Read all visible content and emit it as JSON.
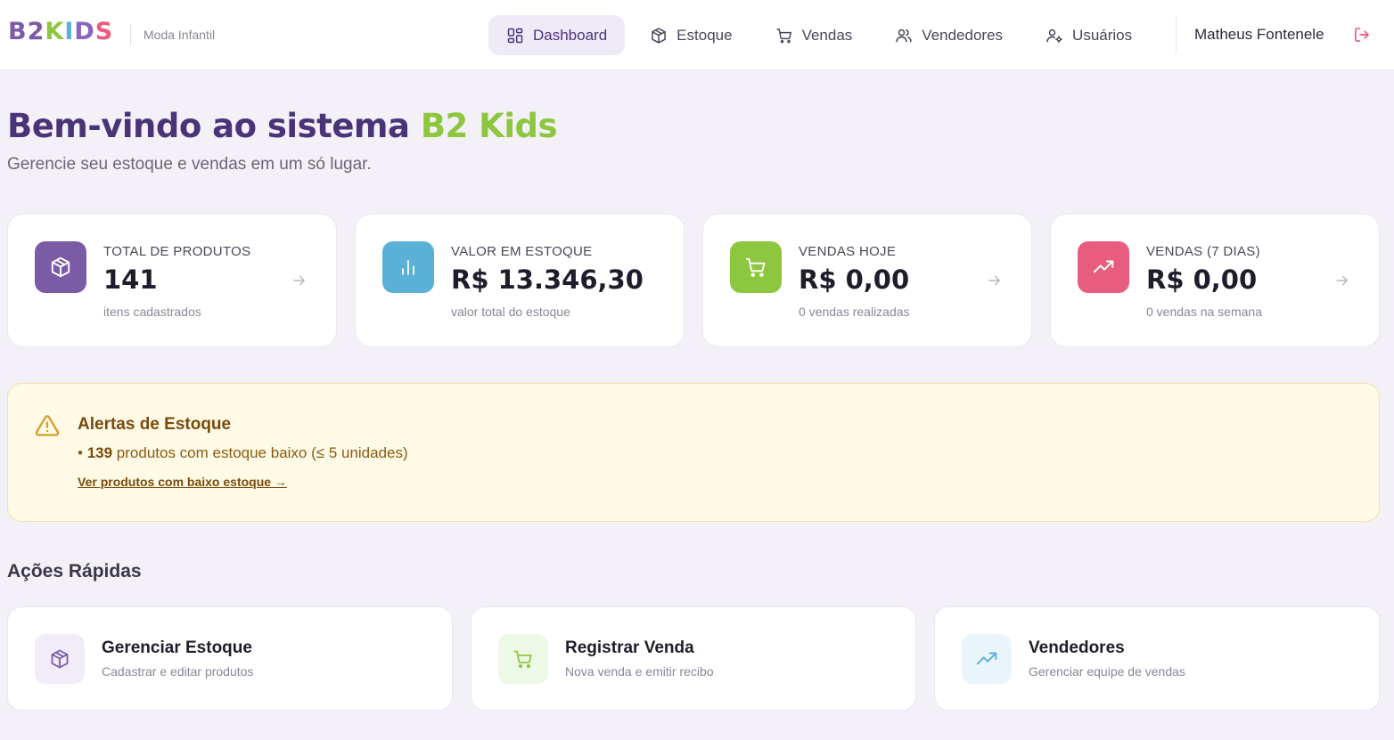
{
  "brand": {
    "letters": [
      {
        "char": "B",
        "color": "#7b5aa6"
      },
      {
        "char": "2",
        "color": "#7b5aa6"
      },
      {
        "char": "K",
        "color": "#8dc63f"
      },
      {
        "char": "I",
        "color": "#5bb0d6"
      },
      {
        "char": "D",
        "color": "#8a63c0"
      },
      {
        "char": "S",
        "color": "#e85c7e"
      }
    ],
    "tagline": "Moda Infantil"
  },
  "nav": {
    "items": [
      {
        "label": "Dashboard",
        "icon": "grid-icon",
        "active": true
      },
      {
        "label": "Estoque",
        "icon": "box-icon",
        "active": false
      },
      {
        "label": "Vendas",
        "icon": "cart-icon",
        "active": false
      },
      {
        "label": "Vendedores",
        "icon": "users-icon",
        "active": false
      },
      {
        "label": "Usuários",
        "icon": "user-cog-icon",
        "active": false
      }
    ],
    "user_name": "Matheus Fontenele",
    "logout_icon": "logout-icon"
  },
  "welcome": {
    "title_prefix": "Bem-vindo ao sistema",
    "title_accent": "B2 Kids",
    "subtitle": "Gerencie seu estoque e vendas em um só lugar."
  },
  "stats": [
    {
      "label": "TOTAL DE PRODUTOS",
      "value": "141",
      "desc": "itens cadastrados",
      "icon": "box-icon",
      "color": "#7b5aa6",
      "has_arrow": true
    },
    {
      "label": "VALOR EM ESTOQUE",
      "value": "R$ 13.346,30",
      "desc": "valor total do estoque",
      "icon": "bar-chart-icon",
      "color": "#5bb0d6",
      "has_arrow": false
    },
    {
      "label": "VENDAS HOJE",
      "value": "R$ 0,00",
      "desc": "0 vendas realizadas",
      "icon": "cart-icon",
      "color": "#8dc63f",
      "has_arrow": true
    },
    {
      "label": "VENDAS (7 DIAS)",
      "value": "R$ 0,00",
      "desc": "0 vendas na semana",
      "icon": "trending-up-icon",
      "color": "#e85c7e",
      "has_arrow": true
    }
  ],
  "alert": {
    "title": "Alertas de Estoque",
    "bullet": "•",
    "count": "139",
    "text": "produtos com estoque baixo (≤ 5 unidades)",
    "link": "Ver produtos com baixo estoque →",
    "color": "#d69e2e"
  },
  "quick_actions": {
    "title": "Ações Rápidas",
    "items": [
      {
        "title": "Gerenciar Estoque",
        "desc": "Cadastrar e editar produtos",
        "icon": "box-icon",
        "color": "#7b5aa6",
        "bg": "#f1ecf8"
      },
      {
        "title": "Registrar Venda",
        "desc": "Nova venda e emitir recibo",
        "icon": "cart-icon",
        "color": "#8dc63f",
        "bg": "#eef8e6"
      },
      {
        "title": "Vendedores",
        "desc": "Gerenciar equipe de vendas",
        "icon": "trending-up-icon",
        "color": "#5bb0d6",
        "bg": "#eaf5fb"
      }
    ]
  }
}
